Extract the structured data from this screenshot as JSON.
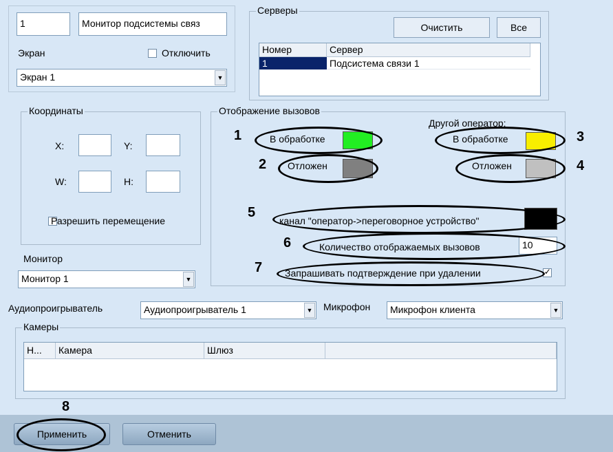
{
  "top": {
    "id_value": "1",
    "name_value": "Монитор подсистемы связ",
    "screen_label": "Экран",
    "disable_label": "Отключить",
    "screen_select": "Экран 1"
  },
  "servers": {
    "legend": "Серверы",
    "clear_label": "Очистить",
    "all_label": "Все",
    "columns": [
      "Номер",
      "Сервер"
    ],
    "rows": [
      {
        "num": "1",
        "server": "Подсистема связи 1"
      }
    ]
  },
  "coords": {
    "legend": "Координаты",
    "x_label": "X:",
    "y_label": "Y:",
    "w_label": "W:",
    "h_label": "H:",
    "allow_move_label": "Разрешить перемещение"
  },
  "monitor": {
    "label": "Монитор",
    "select": "Монитор 1"
  },
  "calls": {
    "legend": "Отображение вызовов",
    "other_operator_label": "Другой оператор:",
    "in_progress_label": "В обработке",
    "postponed_label": "Отложен",
    "other_in_progress_label": "В обработке",
    "other_postponed_label": "Отложен",
    "channel_label": "канал \"оператор->переговорное устройство\"",
    "count_label": "Количество отображаемых вызовов",
    "count_value": "10",
    "confirm_label": "Запрашивать подтверждение при удалении",
    "colors": {
      "in_progress": "#22ee22",
      "postponed": "#808080",
      "other_in_progress": "#f8ee00",
      "other_postponed": "#c0c0c0",
      "channel": "#000000"
    }
  },
  "audio": {
    "player_label": "Аудиопроигрыватель",
    "player_select": "Аудиопроигрыватель 1",
    "mic_label": "Микрофон",
    "mic_select": "Микрофон клиента"
  },
  "cameras": {
    "legend": "Камеры",
    "columns": [
      "Н...",
      "Камера",
      "Шлюз"
    ]
  },
  "annotations": [
    "1",
    "2",
    "3",
    "4",
    "5",
    "6",
    "7",
    "8"
  ],
  "buttons": {
    "apply_label": "Применить",
    "cancel_label": "Отменить"
  }
}
